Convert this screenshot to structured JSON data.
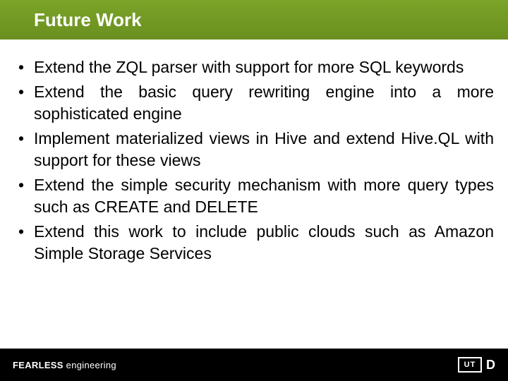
{
  "header": {
    "title": "Future Work"
  },
  "bullets": [
    "Extend the ZQL parser with support for more SQL keywords",
    "Extend the basic query rewriting engine into a more sophisticated engine",
    "Implement materialized views in Hive and extend Hive.QL with support for these views",
    "Extend the simple security mechanism with more query types such as CREATE and DELETE",
    "Extend this work to include public clouds such as Amazon Simple Storage Services"
  ],
  "footer": {
    "brand_bold": "FEARLESS",
    "brand_light": " engineering",
    "logo_box": "UT",
    "logo_d": "D"
  }
}
